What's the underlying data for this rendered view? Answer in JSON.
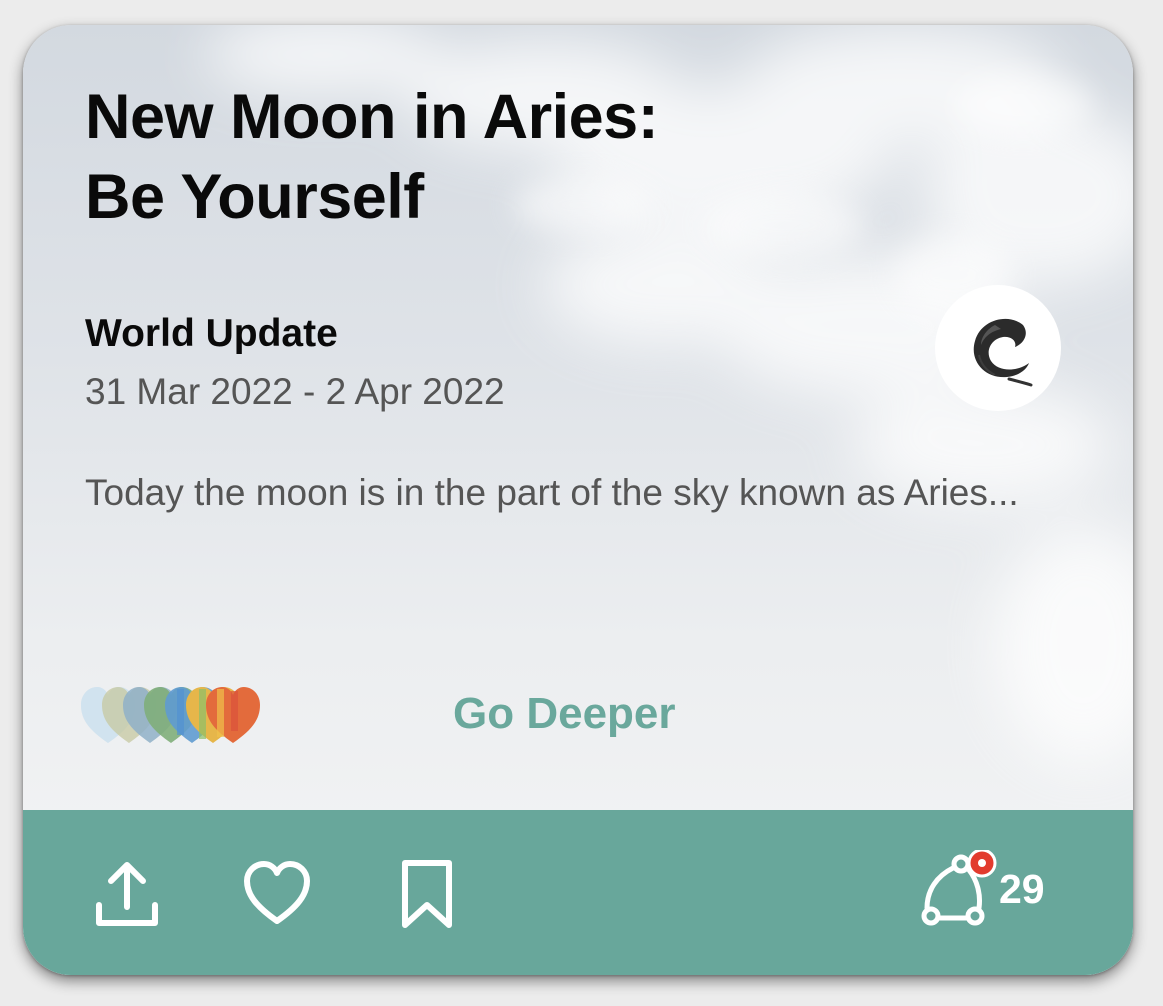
{
  "post": {
    "title_line1": "New Moon in Aries:",
    "title_line2": "Be Yourself",
    "section": "World Update",
    "date_range": "31 Mar 2022 - 2 Apr 2022",
    "excerpt": "Today the moon is in the part of the sky known as Aries...",
    "cta_label": "Go Deeper",
    "author_icon": "ink-swirl-logo"
  },
  "footer": {
    "share_icon": "share-icon",
    "like_icon": "heart-icon",
    "save_icon": "bookmark-icon",
    "connections_icon": "connections-icon",
    "connections_count": "29",
    "has_notification": true
  },
  "colors": {
    "accent": "#68a79b",
    "cta_text": "#6aa89c",
    "notification": "#e23b2e",
    "title": "#0a0a0a",
    "muted_text": "#555555"
  }
}
